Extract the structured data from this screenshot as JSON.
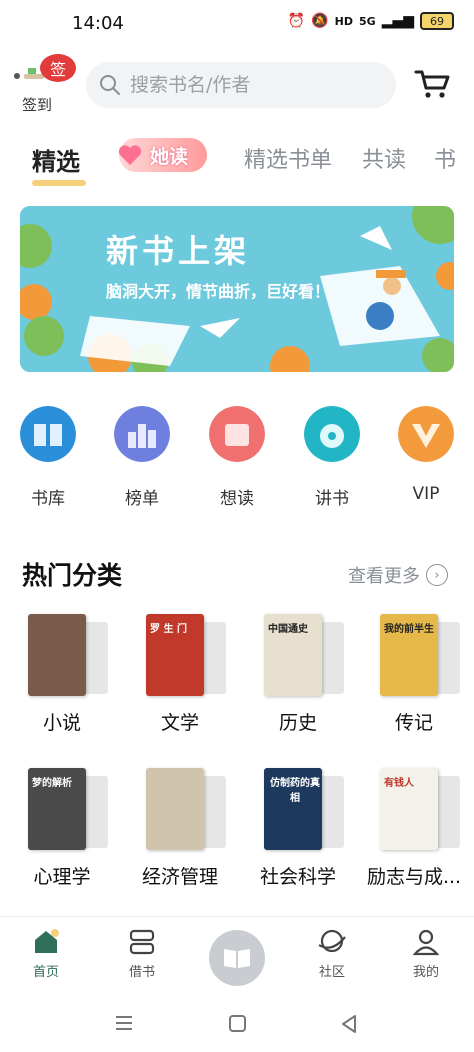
{
  "status_bar": {
    "time": "14:04",
    "network": "5G",
    "hd": "HD",
    "battery": "69"
  },
  "header": {
    "signin_badge": "签",
    "signin_label": "签到",
    "search_placeholder": "搜索书名/作者"
  },
  "tabs": [
    {
      "label": "精选",
      "active": true
    },
    {
      "label": "她读",
      "active": false
    },
    {
      "label": "精选书单",
      "active": false
    },
    {
      "label": "共读",
      "active": false
    },
    {
      "label": "书",
      "active": false
    }
  ],
  "banner": {
    "title": "新书上架",
    "subtitle": "脑洞大开，情节曲折，巨好看！"
  },
  "quick_menu": [
    {
      "label": "书库",
      "icon": "library-icon",
      "color": "#2a8fd8"
    },
    {
      "label": "榜单",
      "icon": "ranking-icon",
      "color": "#6f7fe0"
    },
    {
      "label": "想读",
      "icon": "wishlist-icon",
      "color": "#f07070"
    },
    {
      "label": "讲书",
      "icon": "audio-icon",
      "color": "#21b5c5"
    },
    {
      "label": "VIP",
      "icon": "vip-icon",
      "color": "#f39a3c"
    }
  ],
  "hot_categories": {
    "title": "热门分类",
    "more_label": "查看更多",
    "items": [
      {
        "label": "小说",
        "cover_color": "#7a5a4a"
      },
      {
        "label": "文学",
        "cover_color": "#c0392b",
        "cover_text": "罗 生 门"
      },
      {
        "label": "历史",
        "cover_color": "#e8e0cf",
        "cover_text": "中国通史"
      },
      {
        "label": "传记",
        "cover_color": "#e6b84a",
        "cover_text": "我的前半生"
      },
      {
        "label": "心理学",
        "cover_color": "#4a4a4a",
        "cover_text": "梦的解析"
      },
      {
        "label": "经济管理",
        "cover_color": "#d0c4ad"
      },
      {
        "label": "社会科学",
        "cover_color": "#1d3a5e",
        "cover_text": "仿制药的真相"
      },
      {
        "label": "励志与成...",
        "cover_color": "#f4f0ea",
        "cover_text": "有钱人"
      }
    ]
  },
  "bottom_nav": [
    {
      "label": "首页",
      "active": true
    },
    {
      "label": "借书",
      "active": false
    },
    {
      "label": "",
      "active": false
    },
    {
      "label": "社区",
      "active": false
    },
    {
      "label": "我的",
      "active": false
    }
  ],
  "colors": {
    "accent": "#2f6e57",
    "tab_underline": "#f6cf7a",
    "badge_red": "#e23b3b",
    "banner_bg": "#6dc9dc"
  }
}
